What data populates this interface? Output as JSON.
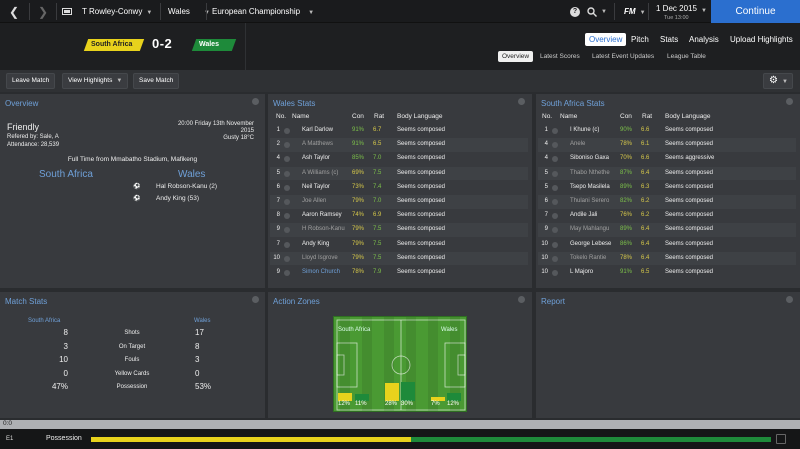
{
  "topbar": {
    "manager": "T Rowley-Conwy",
    "club": "Wales",
    "competition": "European Championship",
    "fm_label": "FM",
    "date": "1 Dec 2015",
    "day_time": "Tue 13:00",
    "continue": "Continue",
    "help": "?"
  },
  "match": {
    "home_team": "South Africa",
    "away_team": "Wales",
    "score": "0-2",
    "home_color": "#e8d21c",
    "away_color": "#1e8a3a"
  },
  "nav": {
    "top": [
      "Overview",
      "Pitch",
      "Stats",
      "Analysis",
      "Upload Highlights"
    ],
    "sub": [
      "Overview",
      "Latest Scores",
      "Latest Event Updates",
      "League Table"
    ]
  },
  "toolbar": {
    "leave": "Leave Match",
    "highlights": "View Highlights",
    "save": "Save Match"
  },
  "overview": {
    "title": "Overview",
    "type": "Friendly",
    "referee": "Refered by: Sale, A",
    "attendance": "Attendance: 28,539",
    "datetime": "20:00 Friday 13th November 2015",
    "weather": "Gusty 18°C",
    "full_time": "Full Time from Mmabatho Stadium, Mafikeng",
    "home": "South Africa",
    "away": "Wales",
    "goals": [
      "Hal Robson-Kanu (2)",
      "Andy King (53)"
    ]
  },
  "wales_stats": {
    "title": "Wales Stats",
    "headers": [
      "No.",
      "Name",
      "Con",
      "Rat",
      "Body Language"
    ],
    "rows": [
      [
        "1",
        "Karl Darlow",
        "91%",
        "6.7",
        "Seems composed"
      ],
      [
        "2",
        "A Matthews",
        "91%",
        "6.5",
        "Seems composed"
      ],
      [
        "4",
        "Ash Taylor",
        "85%",
        "7.0",
        "Seems composed"
      ],
      [
        "5",
        "A Williams (c)",
        "69%",
        "7.5",
        "Seems composed"
      ],
      [
        "6",
        "Neil Taylor",
        "73%",
        "7.4",
        "Seems composed"
      ],
      [
        "7",
        "Joe Allen",
        "79%",
        "7.0",
        "Seems composed"
      ],
      [
        "8",
        "Aaron Ramsey",
        "74%",
        "6.9",
        "Seems composed"
      ],
      [
        "9",
        "H Robson-Kanu",
        "79%",
        "7.5",
        "Seems composed"
      ],
      [
        "7",
        "Andy King",
        "79%",
        "7.5",
        "Seems composed"
      ],
      [
        "10",
        "Lloyd Isgrove",
        "79%",
        "7.5",
        "Seems composed"
      ],
      [
        "9",
        "Simon Church",
        "78%",
        "7.9",
        "Seems composed"
      ]
    ]
  },
  "sa_stats": {
    "title": "South Africa Stats",
    "headers": [
      "No.",
      "Name",
      "Con",
      "Rat",
      "Body Language"
    ],
    "rows": [
      [
        "1",
        "I Khune (c)",
        "90%",
        "6.6",
        "Seems composed"
      ],
      [
        "4",
        "Anele",
        "78%",
        "6.1",
        "Seems composed"
      ],
      [
        "4",
        "Siboniso Gaxa",
        "70%",
        "6.6",
        "Seems aggressive"
      ],
      [
        "5",
        "Thabo Nthethe",
        "87%",
        "6.4",
        "Seems composed"
      ],
      [
        "5",
        "Tsepo Masilela",
        "89%",
        "6.3",
        "Seems composed"
      ],
      [
        "6",
        "Thulani Serero",
        "82%",
        "6.2",
        "Seems composed"
      ],
      [
        "7",
        "Andile Jali",
        "76%",
        "6.2",
        "Seems composed"
      ],
      [
        "9",
        "May Mahlangu",
        "89%",
        "6.4",
        "Seems composed"
      ],
      [
        "10",
        "George Lebese",
        "86%",
        "6.4",
        "Seems composed"
      ],
      [
        "10",
        "Tokelo Rantie",
        "78%",
        "6.4",
        "Seems composed"
      ],
      [
        "10",
        "L Majoro",
        "91%",
        "6.5",
        "Seems composed"
      ]
    ]
  },
  "match_stats": {
    "title": "Match Stats",
    "home": "South Africa",
    "away": "Wales",
    "rows": [
      [
        "8",
        "Shots",
        "17"
      ],
      [
        "3",
        "On Target",
        "8"
      ],
      [
        "10",
        "Fouls",
        "3"
      ],
      [
        "0",
        "Yellow Cards",
        "0"
      ],
      [
        "47%",
        "Possession",
        "53%"
      ]
    ]
  },
  "action_zones": {
    "title": "Action Zones",
    "home": "South Africa",
    "away": "Wales",
    "zones": [
      "12%",
      "11%",
      "28%",
      "30%",
      "7%",
      "12%"
    ],
    "levels": [
      0.12,
      0.11,
      0.28,
      0.3,
      0.07,
      0.12
    ]
  },
  "report": {
    "title": "Report"
  },
  "footer": {
    "clock": "0:0",
    "period": "E1",
    "possession_label": "Possession",
    "home_possession": 0.47
  }
}
